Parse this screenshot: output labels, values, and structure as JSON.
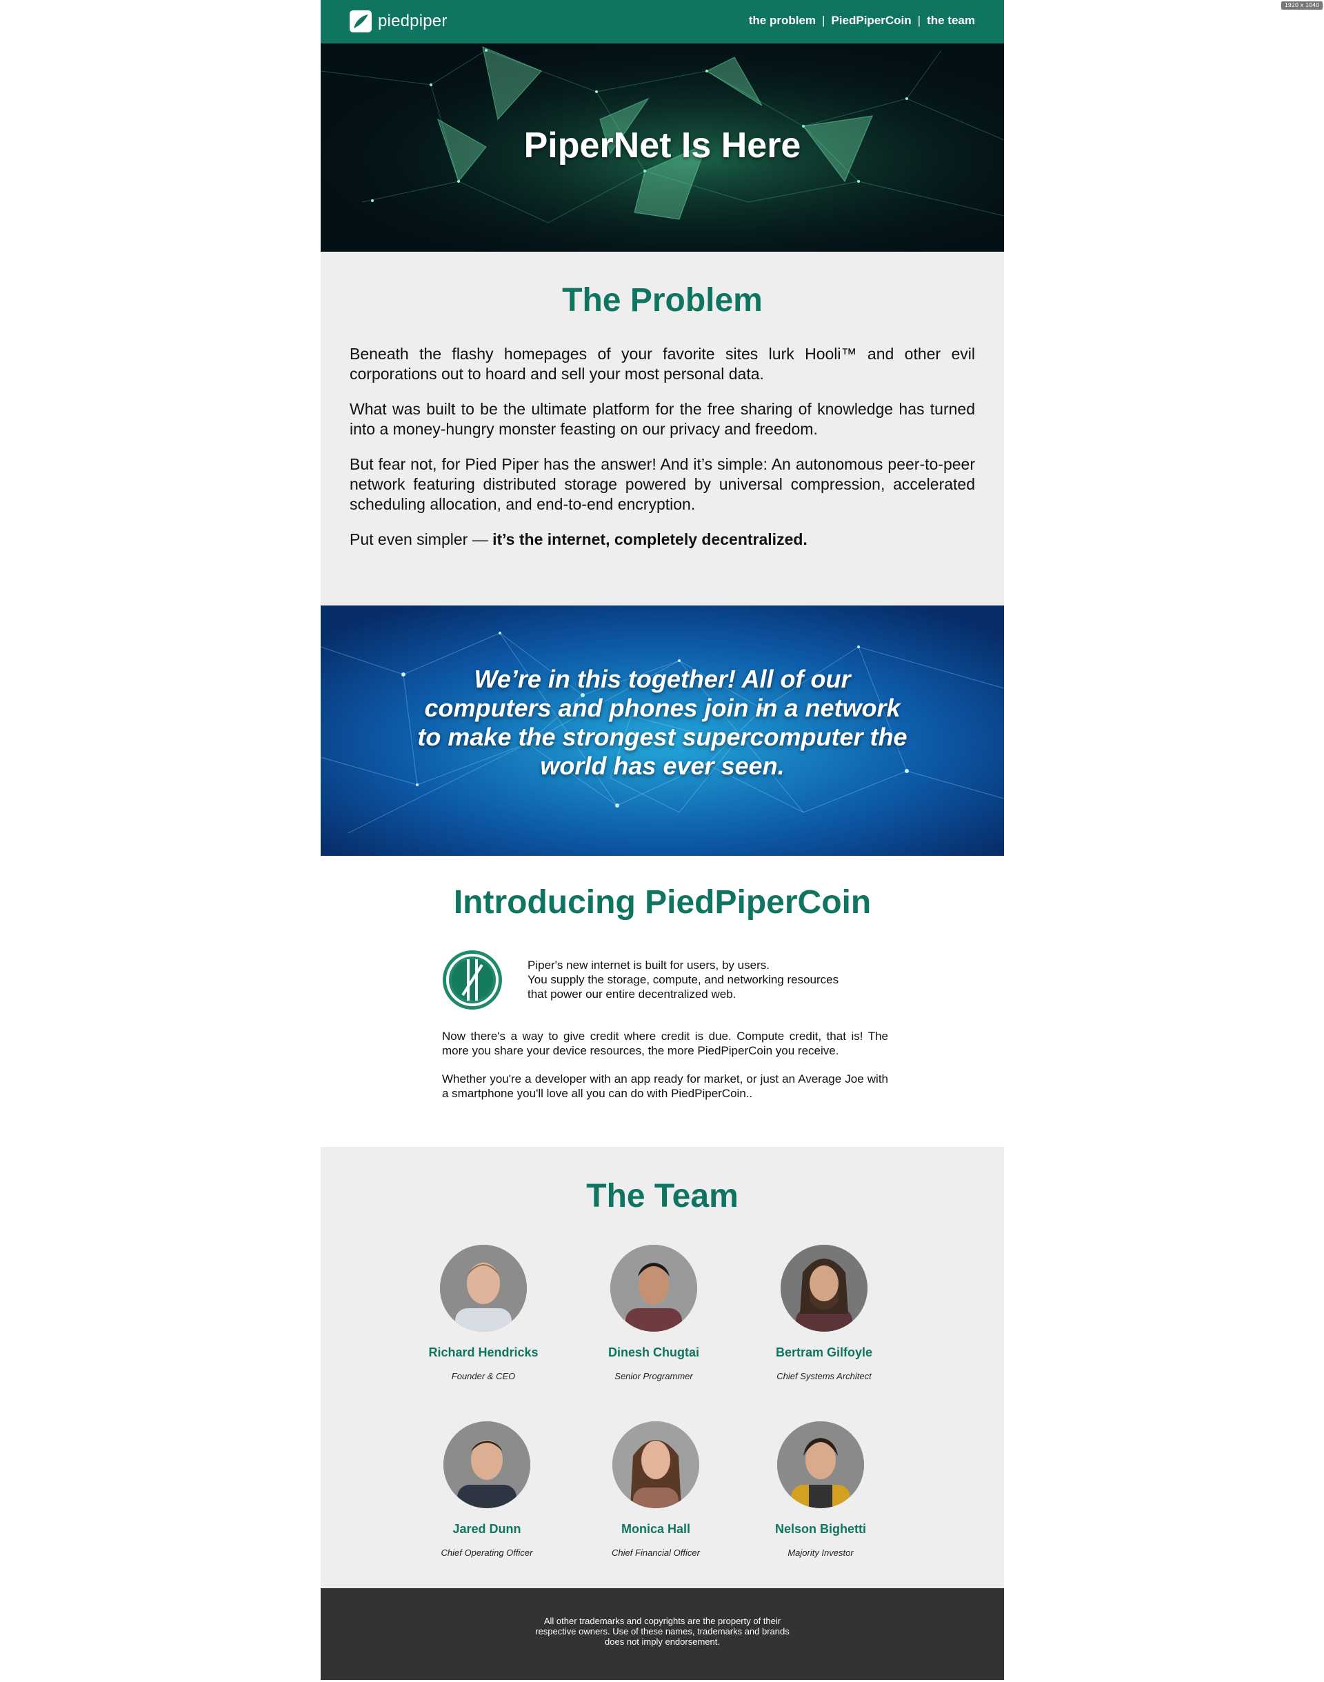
{
  "screen_badge": "1920 x 1040",
  "header": {
    "logo_text": "piedpiper",
    "nav": [
      {
        "label": "the problem"
      },
      {
        "label": "PiedPiperCoin"
      },
      {
        "label": "the team"
      }
    ],
    "separator": "|"
  },
  "hero": {
    "title": "PiperNet Is Here"
  },
  "problem": {
    "title": "The Problem",
    "paragraphs": [
      "Beneath the flashy homepages of your favorite sites lurk Hooli™ and other evil corporations out to hoard and sell your most personal data.",
      "What was built to be the ultimate platform for the free sharing of knowledge has turned into a money-hungry monster feasting on our privacy and freedom.",
      "But fear not, for Pied Piper has the answer! And it’s simple: An autonomous peer-to-peer network featuring distributed storage powered by universal compression, accelerated scheduling allocation, and end-to-end encryption."
    ],
    "final_prefix": "Put even simpler — ",
    "final_bold": "it’s the internet, completely decentralized."
  },
  "banner": {
    "quote": "We’re in this together! All of our computers and phones join in a network to make the strongest supercomputer the world has ever seen."
  },
  "coin": {
    "title": "Introducing PiedPiperCoin",
    "lead_lines": [
      "Piper's new internet is built for users, by users.",
      "You supply the storage, compute, and networking resources",
      "that power our entire decentralized web."
    ],
    "paragraphs": [
      "Now there's a way to give credit where credit is due. Compute credit, that is! The more you share your device resources, the more PiedPiperCoin you receive.",
      "Whether you're a developer with an app ready for market, or just an Average Joe with a smartphone you'll love all you can do with PiedPiperCoin.."
    ]
  },
  "team": {
    "title": "The Team",
    "members": [
      {
        "name": "Richard Hendricks",
        "role": "Founder & CEO"
      },
      {
        "name": "Dinesh Chugtai",
        "role": "Senior Programmer"
      },
      {
        "name": "Bertram Gilfoyle",
        "role": "Chief Systems Architect"
      },
      {
        "name": "Jared Dunn",
        "role": "Chief Operating Officer"
      },
      {
        "name": "Monica Hall",
        "role": "Chief Financial Officer"
      },
      {
        "name": "Nelson Bighetti",
        "role": "Majority Investor"
      }
    ]
  },
  "footer": {
    "lines": [
      "All other trademarks and copyrights are the property of their",
      "respective owners. Use of these names, trademarks and brands",
      "does not imply endorsement."
    ]
  },
  "colors": {
    "brand": "#0f7560",
    "section_bg": "#eeeeee",
    "footer_bg": "#333333"
  }
}
